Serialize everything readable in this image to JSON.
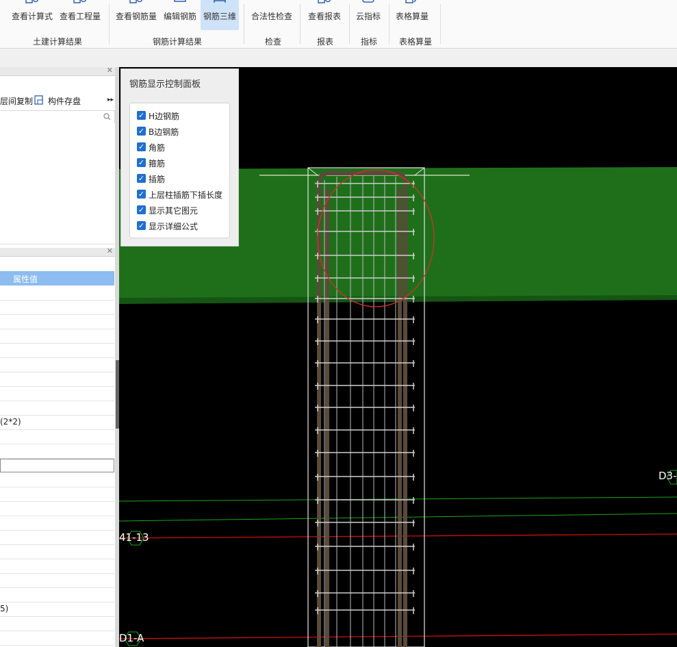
{
  "ribbon": {
    "buttons": [
      {
        "label": "查看计算式"
      },
      {
        "label": "查看工程量"
      },
      {
        "label": "查看钢筋量"
      },
      {
        "label": "编辑钢筋"
      },
      {
        "label": "钢筋三维"
      },
      {
        "label": "合法性检查"
      },
      {
        "label": "查看报表"
      },
      {
        "label": "云指标"
      },
      {
        "label": "表格算量"
      }
    ],
    "groups": [
      {
        "label": "土建计算结果"
      },
      {
        "label": "钢筋计算结果"
      },
      {
        "label": "检查"
      },
      {
        "label": "报表"
      },
      {
        "label": "指标"
      },
      {
        "label": "表格算量"
      }
    ]
  },
  "left_panel": {
    "toolbar": {
      "copy_label": "层间复制",
      "save_label": "构件存盘"
    },
    "property_header": "属性值",
    "property_values": [
      "(2*2)",
      "5)"
    ]
  },
  "viewport": {
    "axis_labels": [
      "D3-",
      "41-13",
      "D1-A"
    ]
  },
  "control_panel": {
    "title": "钢筋显示控制面板",
    "options": [
      {
        "label": "H边钢筋",
        "checked": true
      },
      {
        "label": "B边钢筋",
        "checked": true
      },
      {
        "label": "角筋",
        "checked": true
      },
      {
        "label": "箍筋",
        "checked": true
      },
      {
        "label": "插筋",
        "checked": true
      },
      {
        "label": "上层柱插筋下插长度",
        "checked": true
      },
      {
        "label": "显示其它图元",
        "checked": true
      },
      {
        "label": "显示详细公式",
        "checked": true
      }
    ]
  },
  "colors": {
    "beam": "#1f6f1a",
    "active_tab": "#cfe3f8",
    "header_blue": "#8cbcf0",
    "checkbox": "#1e6fd0",
    "highlight_circle": "#d0312d",
    "axis_red": "#d01010",
    "axis_green": "#1aa81a"
  }
}
